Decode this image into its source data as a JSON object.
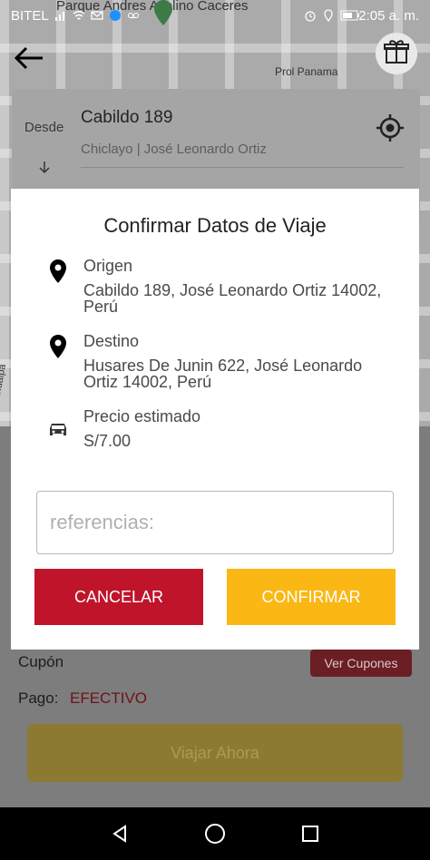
{
  "status_bar": {
    "carrier": "BITEL",
    "time": "2:05 a. m."
  },
  "map": {
    "labels": [
      "Parque Andres Avelino Caceres",
      "Prol Panama",
      "Atahualpa"
    ]
  },
  "route": {
    "from_label": "Desde",
    "from_value": "Cabildo 189",
    "from_sub": "Chiclayo | José Leonardo Ortiz"
  },
  "dialog": {
    "title": "Confirmar Datos de Viaje",
    "origin_title": "Origen",
    "origin_value": "Cabildo 189, José Leonardo Ortiz 14002, Perú",
    "destination_title": "Destino",
    "destination_value": "Husares De Junin 622, José Leonardo Ortiz 14002, Perú",
    "price_title": "Precio estimado",
    "price_value": "S/7.00",
    "references_placeholder": "referencias:",
    "references_value": "",
    "cancel_label": "CANCELAR",
    "confirm_label": "CONFIRMAR"
  },
  "bottom": {
    "coupon_label": "Cupón",
    "coupon_button": "Ver Cupones",
    "payment_label": "Pago:",
    "payment_value": "EFECTIVO",
    "travel_button": "Viajar Ahora"
  },
  "colors": {
    "cancel": "#c0142a",
    "confirm": "#fbb713",
    "payment": "#6e1218",
    "coupon_button": "#6b1e23"
  },
  "icons": [
    "back-arrow-icon",
    "gift-icon",
    "location-target-icon",
    "down-arrow-icon",
    "pin-icon",
    "car-icon",
    "nav-back-icon",
    "nav-home-icon",
    "nav-recents-icon"
  ]
}
